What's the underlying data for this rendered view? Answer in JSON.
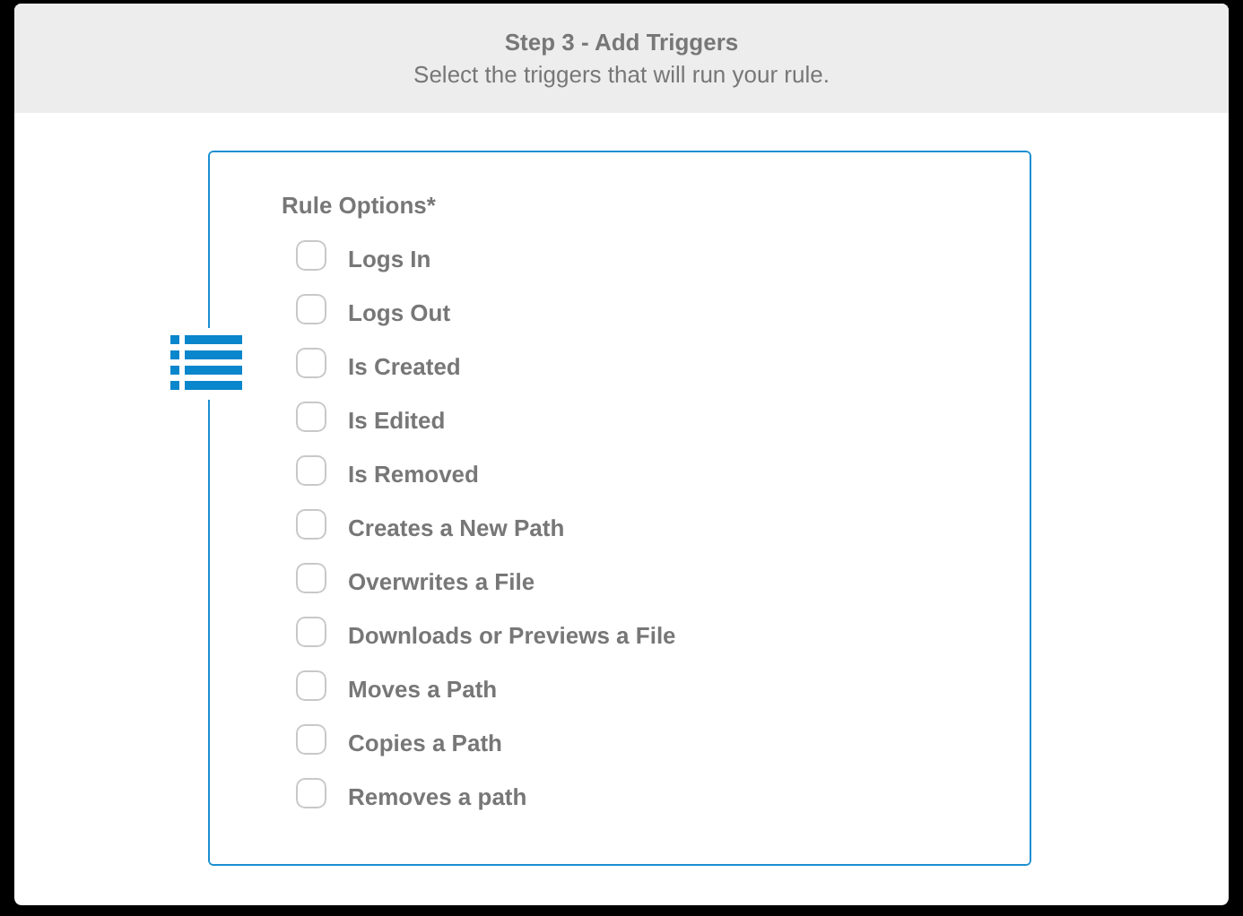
{
  "header": {
    "title": "Step 3 - Add Triggers",
    "subtitle": "Select the triggers that will run your rule."
  },
  "rule_options": {
    "label": "Rule Options*",
    "options": [
      {
        "label": "Logs In",
        "checked": false
      },
      {
        "label": "Logs Out",
        "checked": false
      },
      {
        "label": "Is Created",
        "checked": false
      },
      {
        "label": "Is Edited",
        "checked": false
      },
      {
        "label": "Is Removed",
        "checked": false
      },
      {
        "label": "Creates a New Path",
        "checked": false
      },
      {
        "label": "Overwrites a File",
        "checked": false
      },
      {
        "label": "Downloads or Previews a File",
        "checked": false
      },
      {
        "label": "Moves a Path",
        "checked": false
      },
      {
        "label": "Copies a Path",
        "checked": false
      },
      {
        "label": "Removes a path",
        "checked": false
      }
    ]
  }
}
